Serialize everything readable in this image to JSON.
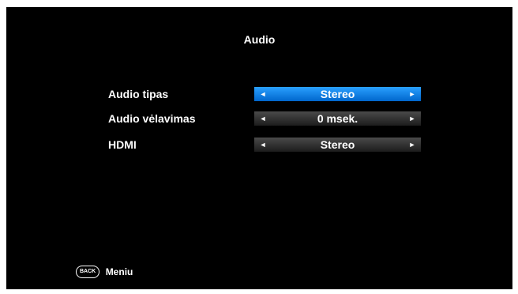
{
  "header": {
    "title": "Audio"
  },
  "settings": [
    {
      "label": "Audio tipas",
      "value": "Stereo",
      "active": true
    },
    {
      "label": "Audio vėlavimas",
      "value": "0 msek.",
      "active": false
    },
    {
      "label": "HDMI",
      "value": "Stereo",
      "active": false
    }
  ],
  "icons": {
    "left": "◄",
    "right": "►"
  },
  "footer": {
    "back_key": "BACK",
    "label": "Meniu"
  },
  "colors": {
    "background": "#000000",
    "highlight": "#1a8cff",
    "inactive": "#333333",
    "text": "#ffffff"
  }
}
